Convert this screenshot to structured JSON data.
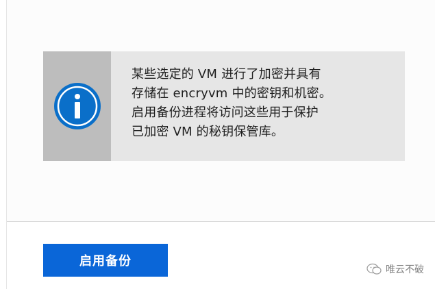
{
  "banner": {
    "icon": "info-icon",
    "lines": [
      "某些选定的 VM 进行了加密并具有",
      "存储在 encryvm 中的密钥和机密。",
      "启用备份进程将访问这些用于保护",
      "已加密 VM 的秘钥保管库。"
    ]
  },
  "actions": {
    "enable_backup_label": "启用备份"
  },
  "watermark": {
    "icon": "wechat-icon",
    "text": "唯云不破"
  },
  "colors": {
    "accent": "#0a66d8",
    "info_icon": "#0a6fc9",
    "banner_bg": "#e6e6e6",
    "banner_icon_bg": "#bdbdbd"
  }
}
